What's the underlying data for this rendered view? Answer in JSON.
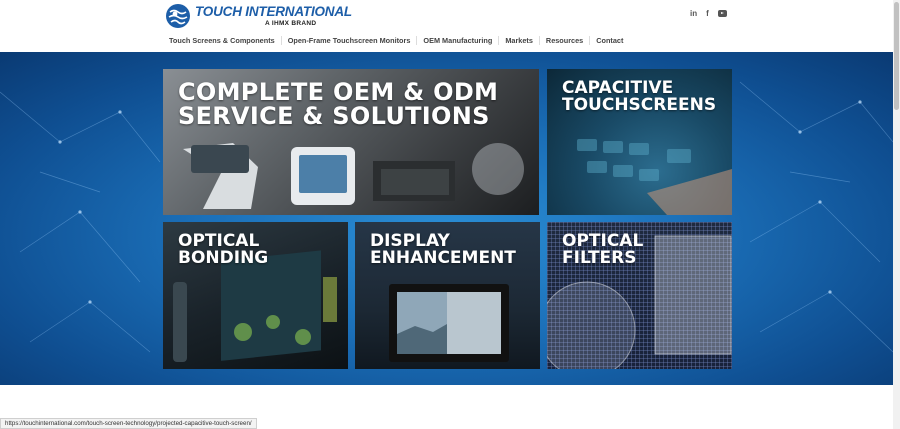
{
  "header": {
    "logo_brand": "TOUCH INTERNATIONAL",
    "logo_sub": "A ІHMX BRAND",
    "social": {
      "linkedin": "in",
      "facebook": "f"
    }
  },
  "nav": {
    "items": [
      {
        "label": "Touch Screens & Components"
      },
      {
        "label": "Open-Frame Touchscreen Monitors"
      },
      {
        "label": "OEM Manufacturing"
      },
      {
        "label": "Markets"
      },
      {
        "label": "Resources"
      },
      {
        "label": "Contact"
      }
    ]
  },
  "tiles": {
    "oem": {
      "line1": "COMPLETE OEM & ODM",
      "line2": "SERVICE & SOLUTIONS"
    },
    "capacitive": {
      "line1": "CAPACITIVE",
      "line2": "TOUCHSCREENS"
    },
    "optical_bonding": {
      "line1": "OPTICAL",
      "line2": "BONDING"
    },
    "display": {
      "line1": "DISPLAY",
      "line2": "ENHANCEMENT"
    },
    "filters": {
      "line1": "OPTICAL",
      "line2": "FILTERS"
    }
  },
  "status_url": "https://touchinternational.com/touch-screen-technology/projected-capacitive-touch-screen/",
  "colors": {
    "brand_blue": "#1d5ea8",
    "hero_blue": "#1b6fb8",
    "nav_text": "#444444"
  },
  "icons": [
    "globe-logo-icon",
    "linkedin-icon",
    "facebook-icon",
    "youtube-icon"
  ]
}
